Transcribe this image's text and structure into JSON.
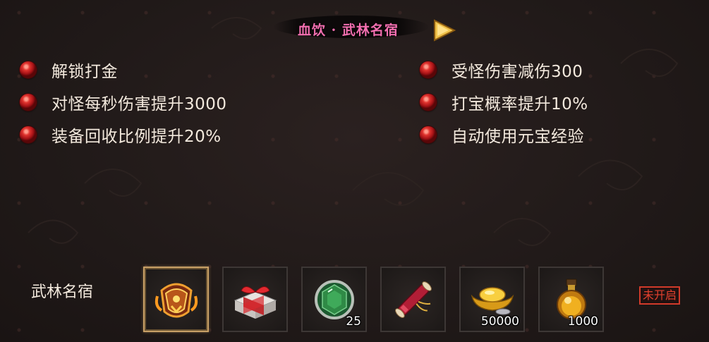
{
  "header": {
    "title": "血饮 · 武林名宿"
  },
  "attributes_left": [
    {
      "text": "解锁打金"
    },
    {
      "text": "对怪每秒伤害提升3000"
    },
    {
      "text": "装备回收比例提升20%"
    }
  ],
  "attributes_right": [
    {
      "text": "受怪伤害减伤300"
    },
    {
      "text": "打宝概率提升10%"
    },
    {
      "text": "自动使用元宝经验"
    }
  ],
  "rewards": {
    "label": "武林名宿",
    "items": [
      {
        "icon": "golden-armor-icon",
        "count": ""
      },
      {
        "icon": "gift-box-icon",
        "count": ""
      },
      {
        "icon": "green-gem-icon",
        "count": "25"
      },
      {
        "icon": "scroll-icon",
        "count": ""
      },
      {
        "icon": "gold-ingot-icon",
        "count": "50000"
      },
      {
        "icon": "potion-bottle-icon",
        "count": "1000"
      }
    ],
    "status_badge": "未开启"
  },
  "colors": {
    "title": "#f36fb0",
    "text": "#f3e9dd",
    "badge": "#e2412e",
    "orb": "#c0201f"
  }
}
